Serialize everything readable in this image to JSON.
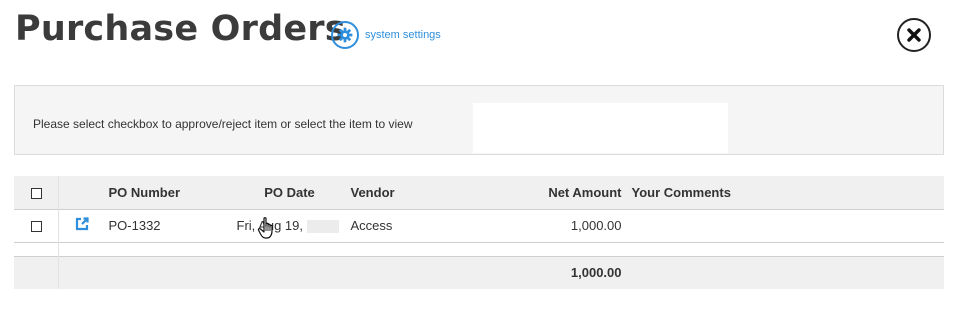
{
  "header": {
    "title": "Purchase Orders",
    "settings_label": "system settings"
  },
  "info": {
    "message": "Please select checkbox to approve/reject item or select the item to view"
  },
  "table": {
    "columns": {
      "po_number": "PO Number",
      "po_date": "PO Date",
      "vendor": "Vendor",
      "net_amount": "Net Amount",
      "comments": "Your Comments"
    },
    "rows": [
      {
        "po_number": "PO-1332",
        "po_date": "Fri, Aug 19,",
        "vendor": "Access",
        "net_amount": "1,000.00",
        "comments": ""
      }
    ],
    "total": "1,000.00"
  },
  "icons": {
    "settings": "gear-icon",
    "close": "close-icon",
    "open": "external-link-icon",
    "cursor": "hand-pointer-icon"
  },
  "colors": {
    "accent": "#2f8fdc",
    "header_bg": "#f0f0f0"
  }
}
